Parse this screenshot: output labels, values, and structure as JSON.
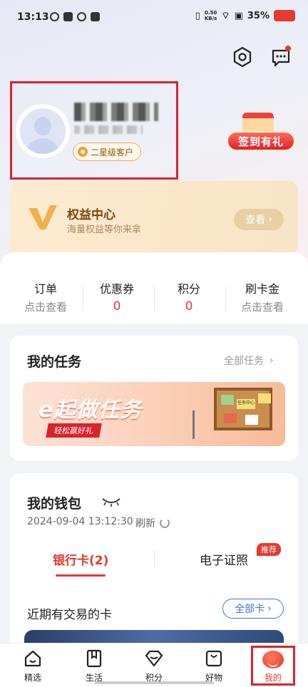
{
  "status_bar": {
    "time": "13:13",
    "net_speed_value": "0.50",
    "net_speed_unit": "KB/s",
    "battery": "35%"
  },
  "profile": {
    "level_badge": "二星级客户"
  },
  "signin": {
    "label": "签到有礼"
  },
  "benefits": {
    "title": "权益中心",
    "subtitle": "海量权益等你来拿",
    "view_button": "查看"
  },
  "stats": [
    {
      "label": "订单",
      "value": "点击查看"
    },
    {
      "label": "优惠券",
      "value": "0"
    },
    {
      "label": "积分",
      "value": "0"
    },
    {
      "label": "刷卡金",
      "value": "点击查看"
    }
  ],
  "tasks": {
    "title": "我的任务",
    "all_link": "全部任务",
    "banner_title": "e起做任务",
    "banner_tag": "轻松赢好礼",
    "board_label": "任务中心"
  },
  "wallet": {
    "title": "我的钱包",
    "timestamp": "2024-09-04 13:12:30",
    "refresh_label": "刷新",
    "tab_bank": "银行卡(2)",
    "tab_cert": "电子证照",
    "tab_cert_tag": "推荐",
    "recent_title": "近期有交易的卡",
    "all_cards_button": "全部卡"
  },
  "bottom_nav": [
    {
      "label": "精选"
    },
    {
      "label": "生活"
    },
    {
      "label": "积分"
    },
    {
      "label": "好物"
    },
    {
      "label": "我的"
    }
  ],
  "colors": {
    "accent_red": "#e53a2f",
    "highlight_box": "#d9232d",
    "link_blue": "#3b74d9"
  }
}
